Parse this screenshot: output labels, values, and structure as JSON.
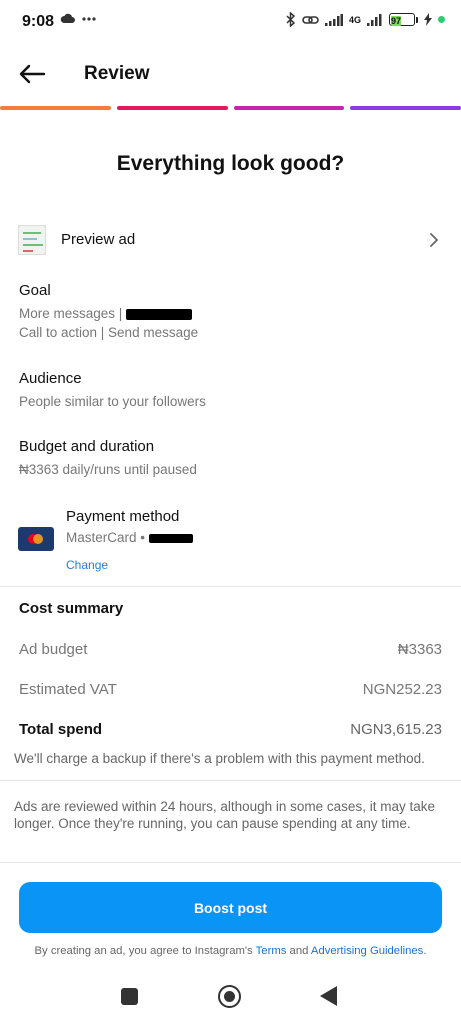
{
  "status_bar": {
    "time": "9:08",
    "network": "4G",
    "battery": "97"
  },
  "header": {
    "title": "Review"
  },
  "progress": {
    "steps": 4,
    "current": 4,
    "colors": [
      "#f57c3b",
      "#e5175d",
      "#c624b0",
      "#8c3ae6"
    ]
  },
  "headline": "Everything look good?",
  "preview": {
    "label": "Preview ad"
  },
  "goal": {
    "title": "Goal",
    "line1": "More messages |",
    "line2": "Call to action | Send message"
  },
  "audience": {
    "title": "Audience",
    "value": "People similar to your followers"
  },
  "budget": {
    "title": "Budget and duration",
    "value": "₦3363 daily/runs until paused"
  },
  "payment": {
    "title": "Payment method",
    "card": "MasterCard •",
    "change_label": "Change"
  },
  "cost_summary": {
    "title": "Cost summary",
    "ad_budget_label": "Ad budget",
    "ad_budget_value": "₦3363",
    "vat_label": "Estimated VAT",
    "vat_value": "NGN252.23",
    "total_label": "Total spend",
    "total_value": "NGN3,615.23",
    "backup_note": "We'll charge a backup if there's a problem with this payment method."
  },
  "review_note": "Ads are reviewed within 24 hours, although in some cases, it may take longer. Once they're running, you can pause spending at any time.",
  "boost_button": "Boost post",
  "legal": {
    "prefix": "By creating an ad, you agree to Instagram's ",
    "terms": "Terms",
    "and": " and ",
    "guidelines": "Advertising Guidelines",
    "suffix": "."
  },
  "accent_color": "#0a95f6"
}
